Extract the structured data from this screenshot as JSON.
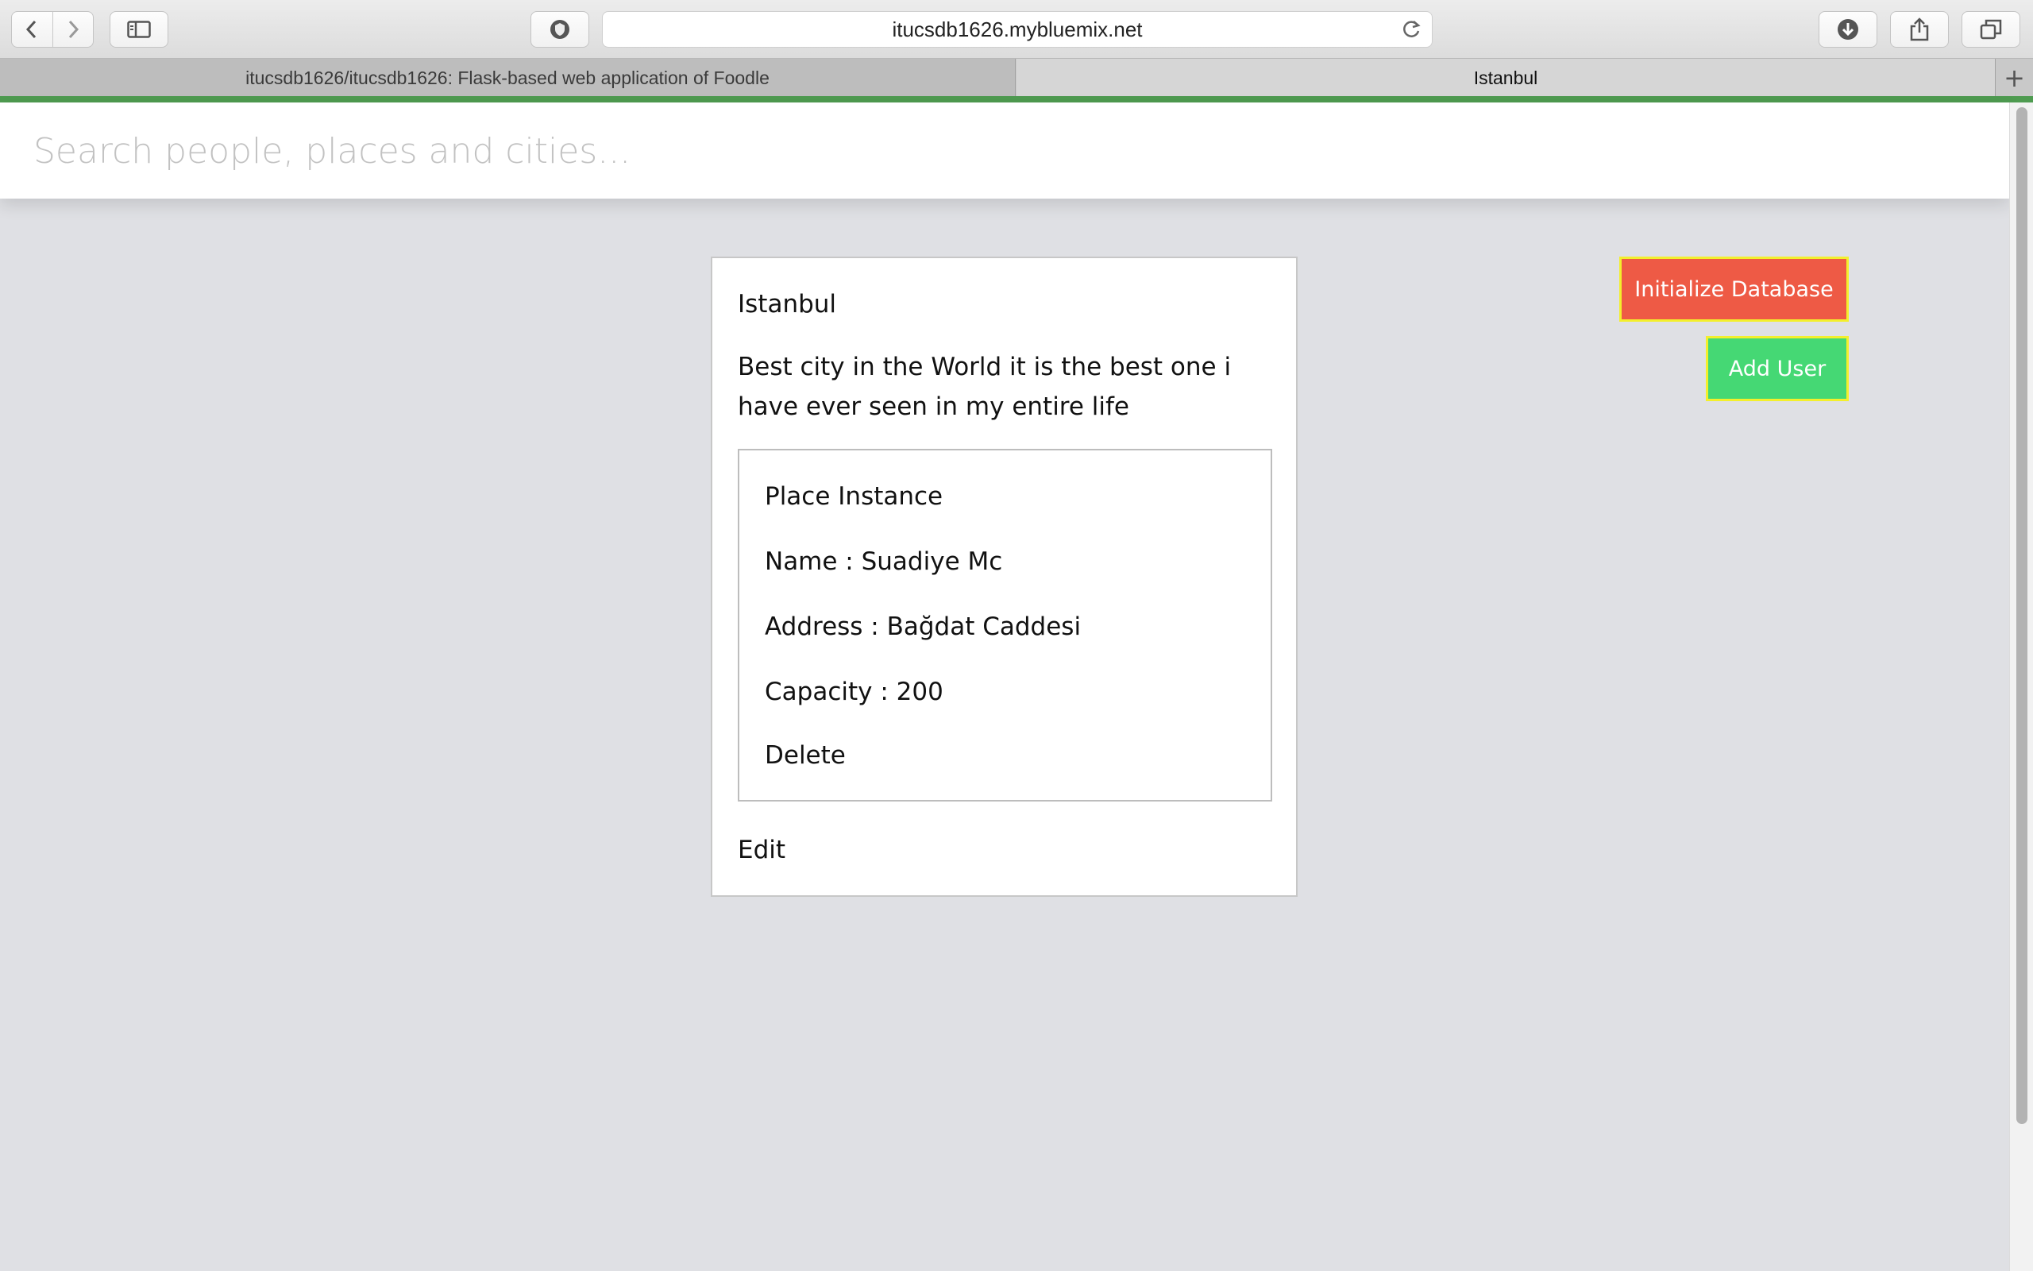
{
  "browser": {
    "url": "itucsdb1626.mybluemix.net",
    "tabs": [
      {
        "label": "itucsdb1626/itucsdb1626: Flask-based web application of Foodle"
      },
      {
        "label": "Istanbul"
      }
    ],
    "new_tab": "+"
  },
  "search": {
    "placeholder": "Search people, places and cities..."
  },
  "city": {
    "name": "Istanbul",
    "description": "Best city in the World it is the best one i have ever seen in my entire life",
    "edit_label": "Edit"
  },
  "place": {
    "heading": "Place Instance",
    "name": "Name : Suadiye Mc",
    "address": "Address : Bağdat Caddesi",
    "capacity": "Capacity : 200",
    "delete_label": "Delete"
  },
  "actions": {
    "init_db_label": "Initialize Database",
    "add_user_label": "Add User"
  },
  "colors": {
    "init_button": "#ee5a45",
    "add_user_button": "#45d874",
    "button_border": "#f3ef2c",
    "progress_bar": "#4e9b50"
  }
}
